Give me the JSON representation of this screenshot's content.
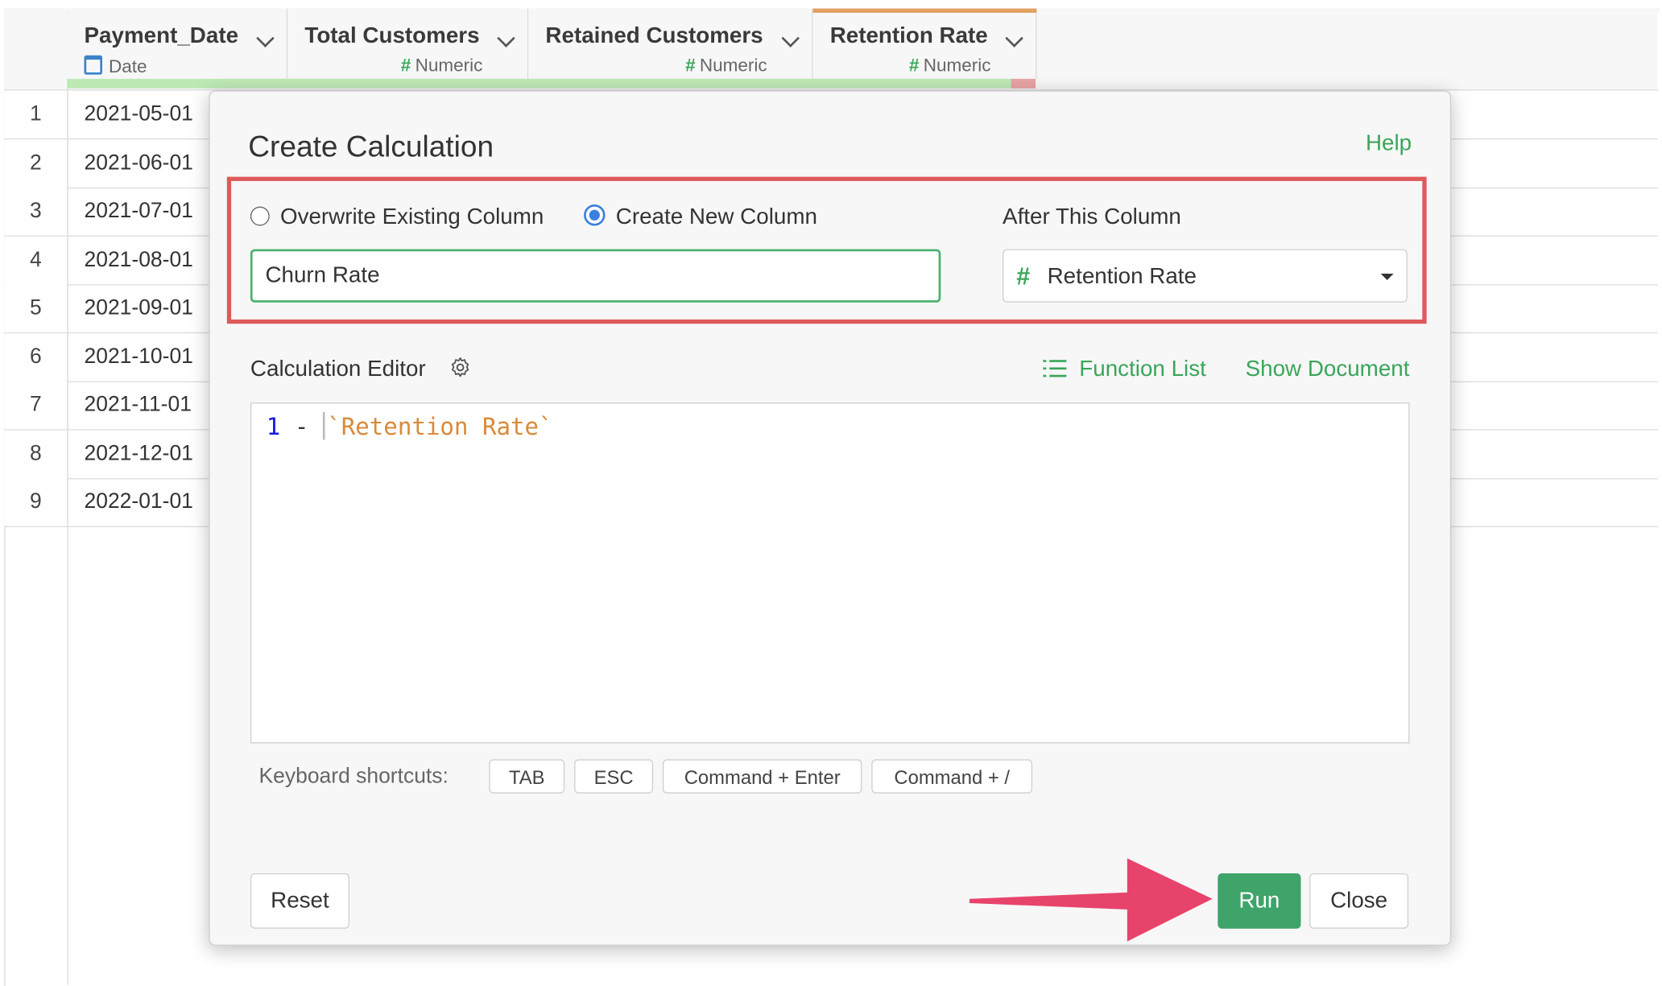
{
  "grid": {
    "columns": [
      {
        "name": "Payment_Date",
        "type": "Date"
      },
      {
        "name": "Total Customers",
        "type": "Numeric"
      },
      {
        "name": "Retained Customers",
        "type": "Numeric"
      },
      {
        "name": "Retention Rate",
        "type": "Numeric"
      }
    ],
    "rows": [
      {
        "num": "1",
        "date": "2021-05-01"
      },
      {
        "num": "2",
        "date": "2021-06-01"
      },
      {
        "num": "3",
        "date": "2021-07-01"
      },
      {
        "num": "4",
        "date": "2021-08-01"
      },
      {
        "num": "5",
        "date": "2021-09-01"
      },
      {
        "num": "6",
        "date": "2021-10-01"
      },
      {
        "num": "7",
        "date": "2021-11-01"
      },
      {
        "num": "8",
        "date": "2021-12-01"
      },
      {
        "num": "9",
        "date": "2022-01-01"
      }
    ],
    "type_icon_numeric": "#"
  },
  "dialog": {
    "title": "Create Calculation",
    "help": "Help",
    "radio_overwrite": "Overwrite Existing Column",
    "radio_create": "Create New Column",
    "radio_selected": "Create New Column",
    "after_label": "After This Column",
    "column_name_value": "Churn Rate",
    "after_column_value": "Retention Rate",
    "editor_label": "Calculation Editor",
    "function_list": "Function List",
    "show_document": "Show Document",
    "code": {
      "number": "1",
      "operator": " - ",
      "column_ref": "`Retention Rate`"
    },
    "shortcuts_label": "Keyboard shortcuts:",
    "shortcuts": [
      "TAB",
      "ESC",
      "Command + Enter",
      "Command + /"
    ],
    "reset": "Reset",
    "run": "Run",
    "close": "Close"
  },
  "colors": {
    "accent_green": "#3fa469",
    "highlight_red": "#dd5a5a",
    "arrow_pink": "#e8436b",
    "radio_blue": "#3b7fe0"
  },
  "icons": [
    "calendar-icon",
    "chevron-down-icon",
    "gear-icon",
    "list-icon",
    "caret-down-icon",
    "pointer-arrow"
  ]
}
